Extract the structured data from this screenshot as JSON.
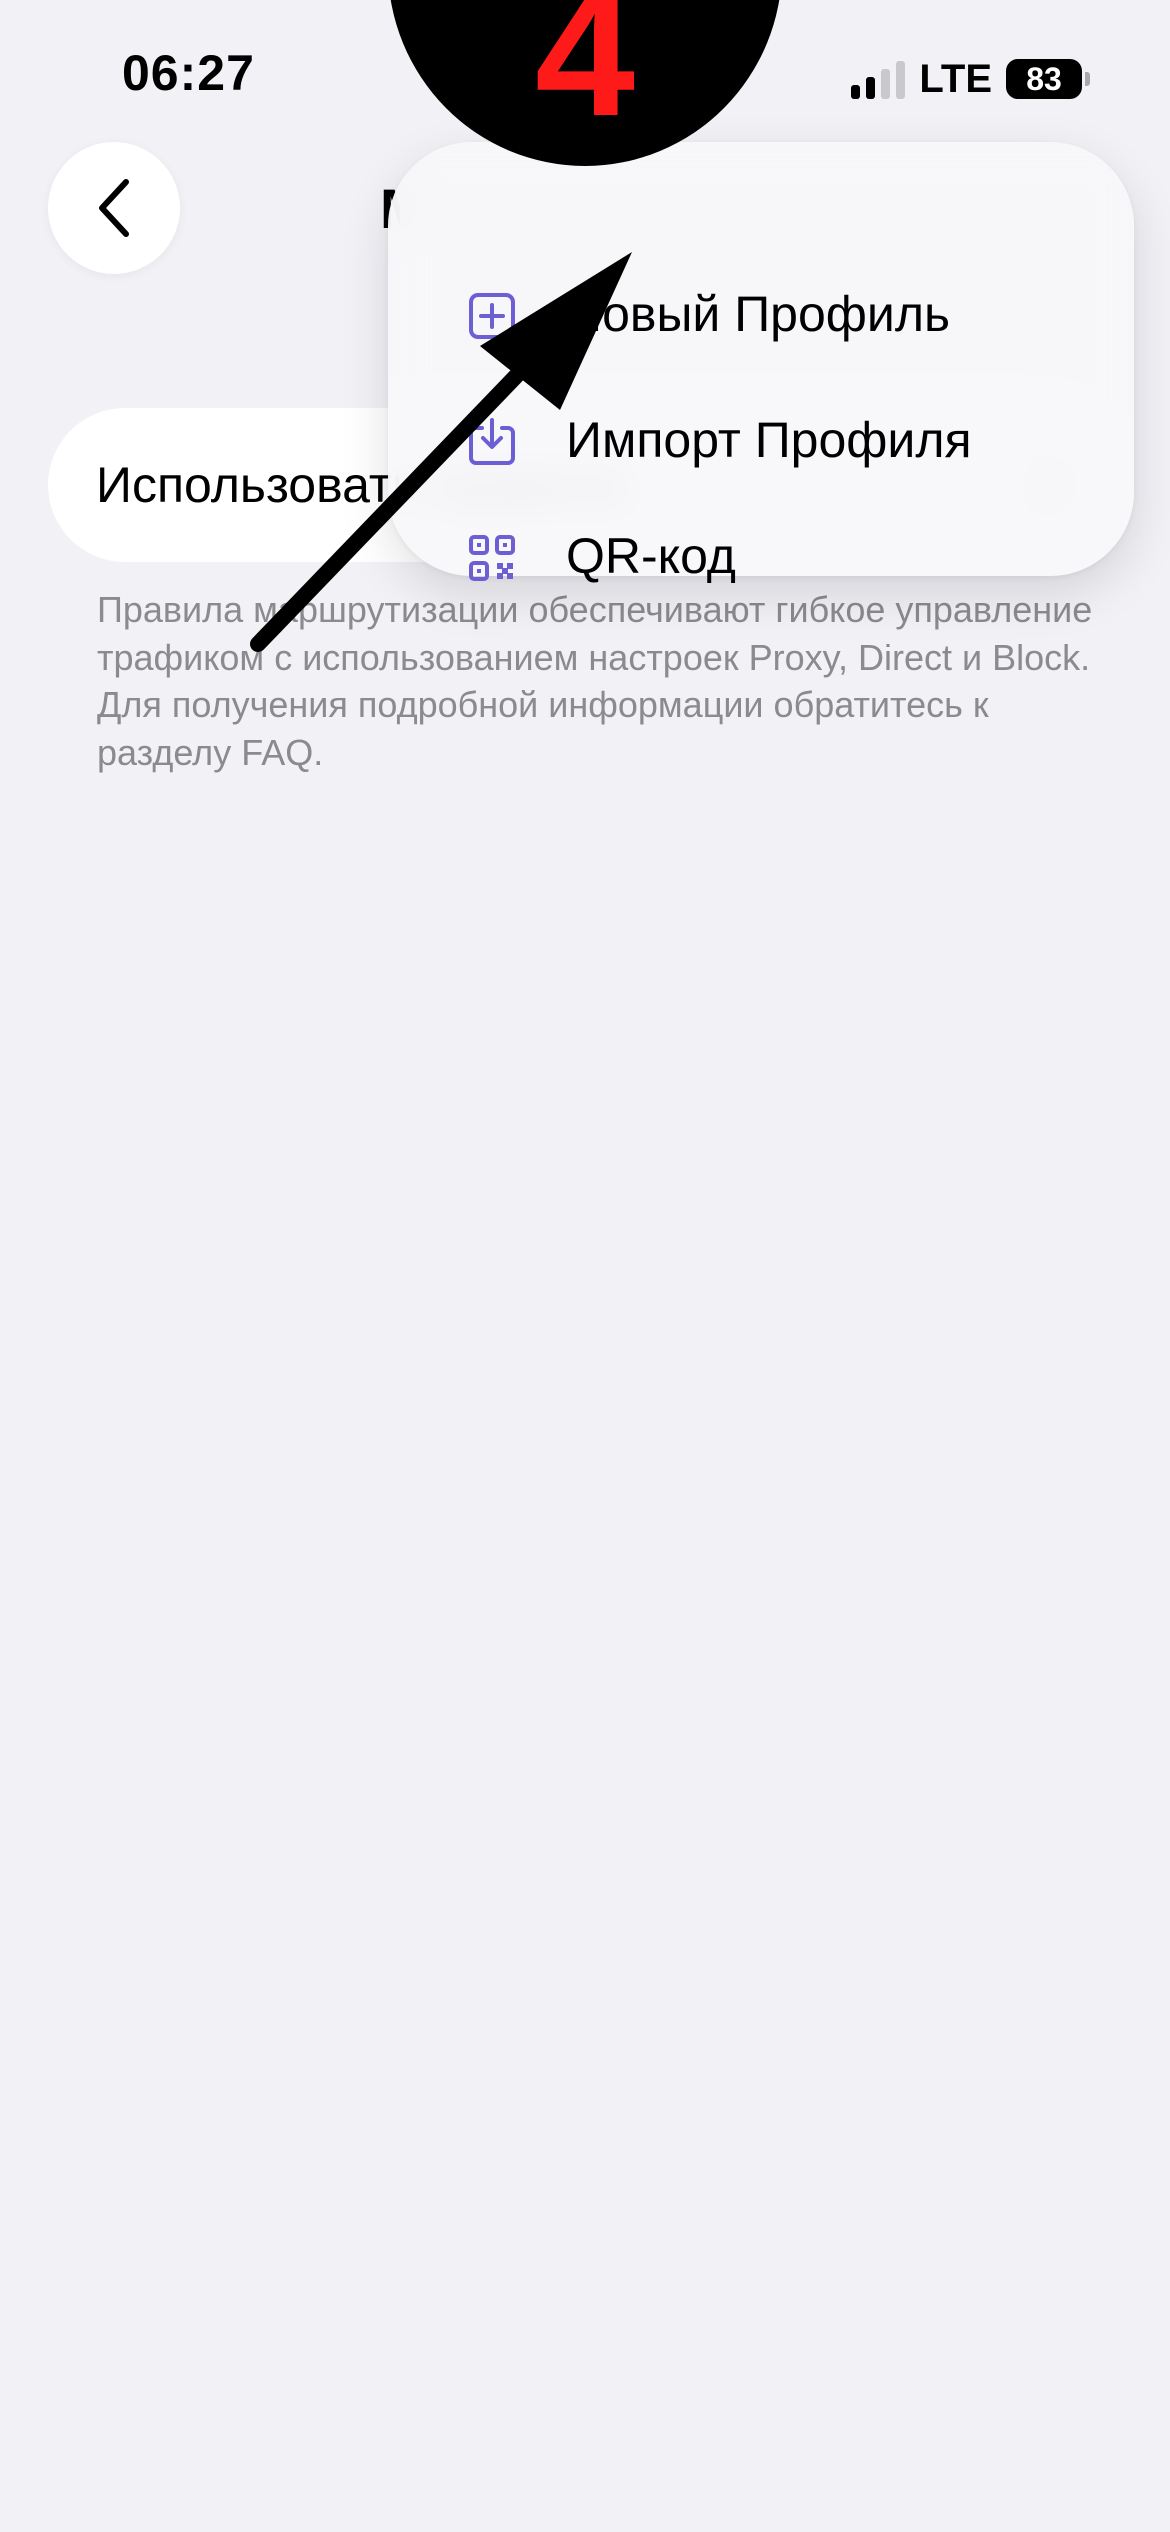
{
  "status_bar": {
    "time": "06:27",
    "network": "LTE",
    "battery": "83"
  },
  "nav": {
    "back_icon": "chevron-left-icon",
    "title_fragment": "М"
  },
  "settings": {
    "use_rules_label": "Использовать правила",
    "use_rules_enabled": false,
    "description_lines": [
      "Правила маршрутизации обеспечивают гибкое управление трафиком с использованием настроек Proxy, Direct и Block.",
      "Для получения подробной информации обратитесь к разделу FAQ."
    ]
  },
  "popup_menu": {
    "items": [
      {
        "label": "Новый Профиль",
        "icon": "plus-square-icon"
      },
      {
        "label": "Импорт Профиля",
        "icon": "download-icon"
      },
      {
        "label": "QR-код",
        "icon": "qr-code-icon"
      }
    ],
    "accent_color": "#6b5fd3"
  },
  "tutorial": {
    "step_number": "4",
    "badge_color": "#000000",
    "number_color": "#ff1a1a",
    "arrow_color": "#000000"
  }
}
